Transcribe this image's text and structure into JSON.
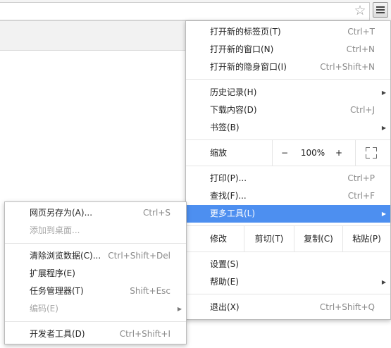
{
  "toolbar": {
    "star_icon": "star-icon",
    "menu_icon": "hamburger-menu-icon"
  },
  "menu": {
    "new_tab": {
      "label": "打开新的标签页(T)",
      "shortcut": "Ctrl+T"
    },
    "new_window": {
      "label": "打开新的窗口(N)",
      "shortcut": "Ctrl+N"
    },
    "new_incognito": {
      "label": "打开新的隐身窗口(I)",
      "shortcut": "Ctrl+Shift+N"
    },
    "history": {
      "label": "历史记录(H)"
    },
    "downloads": {
      "label": "下载内容(D)",
      "shortcut": "Ctrl+J"
    },
    "bookmarks": {
      "label": "书签(B)"
    },
    "zoom": {
      "label": "缩放",
      "minus": "−",
      "value": "100%",
      "plus": "+"
    },
    "print": {
      "label": "打印(P)...",
      "shortcut": "Ctrl+P"
    },
    "find": {
      "label": "查找(F)...",
      "shortcut": "Ctrl+F"
    },
    "more_tools": {
      "label": "更多工具(L)"
    },
    "edit": {
      "label": "修改",
      "cut": "剪切(T)",
      "copy": "复制(C)",
      "paste": "粘贴(P)"
    },
    "settings": {
      "label": "设置(S)"
    },
    "help": {
      "label": "帮助(E)"
    },
    "exit": {
      "label": "退出(X)",
      "shortcut": "Ctrl+Shift+Q"
    }
  },
  "submenu": {
    "save_page": {
      "label": "网页另存为(A)...",
      "shortcut": "Ctrl+S"
    },
    "add_to_desktop": {
      "label": "添加到桌面..."
    },
    "clear_data": {
      "label": "清除浏览数据(C)...",
      "shortcut": "Ctrl+Shift+Del"
    },
    "extensions": {
      "label": "扩展程序(E)"
    },
    "task_manager": {
      "label": "任务管理器(T)",
      "shortcut": "Shift+Esc"
    },
    "encoding": {
      "label": "编码(E)"
    },
    "devtools": {
      "label": "开发者工具(D)",
      "shortcut": "Ctrl+Shift+I"
    }
  },
  "colors": {
    "highlight": "#4d8ff0",
    "shortcut_text": "#8a8a8a",
    "disabled_text": "#a8a8a8"
  }
}
